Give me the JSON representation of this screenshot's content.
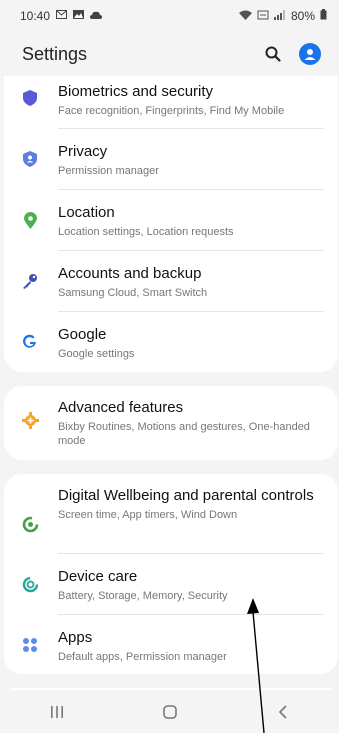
{
  "status": {
    "time": "10:40",
    "battery": "80%",
    "left_icons": [
      "mail-icon",
      "image-icon",
      "cloud-icon"
    ],
    "right_icons": [
      "wifi-icon",
      "volte-icon",
      "signal-icon",
      "battery-icon"
    ]
  },
  "header": {
    "title": "Settings"
  },
  "colors": {
    "accent": "#1a73e8"
  },
  "groups": [
    {
      "items": [
        {
          "title": "Biometrics and security",
          "subtitle": "Face recognition, Fingerprints, Find My Mobile",
          "icon": "shield-icon",
          "icon_color": "#5a5ad8"
        },
        {
          "title": "Privacy",
          "subtitle": "Permission manager",
          "icon": "privacy-shield-icon",
          "icon_color": "#5a7fe0"
        },
        {
          "title": "Location",
          "subtitle": "Location settings, Location requests",
          "icon": "location-pin-icon",
          "icon_color": "#4caf50"
        },
        {
          "title": "Accounts and backup",
          "subtitle": "Samsung Cloud, Smart Switch",
          "icon": "key-icon",
          "icon_color": "#3f51b5"
        },
        {
          "title": "Google",
          "subtitle": "Google settings",
          "icon": "google-icon",
          "icon_color": "#1a73e8"
        }
      ]
    },
    {
      "items": [
        {
          "title": "Advanced features",
          "subtitle": "Bixby Routines, Motions and gestures, One-handed mode",
          "icon": "gear-plus-icon",
          "icon_color": "#f5a623"
        }
      ]
    },
    {
      "items": [
        {
          "title": "Digital Wellbeing and parental controls",
          "subtitle": "Screen time, App timers, Wind Down",
          "icon": "wellbeing-icon",
          "icon_color": "#43a047"
        },
        {
          "title": "Device care",
          "subtitle": "Battery, Storage, Memory, Security",
          "icon": "device-care-icon",
          "icon_color": "#26a69a"
        },
        {
          "title": "Apps",
          "subtitle": "Default apps, Permission manager",
          "icon": "apps-grid-icon",
          "icon_color": "#5c8de8"
        }
      ]
    }
  ],
  "navbar": {
    "recents": "recents-icon",
    "home": "home-icon",
    "back": "back-icon"
  }
}
